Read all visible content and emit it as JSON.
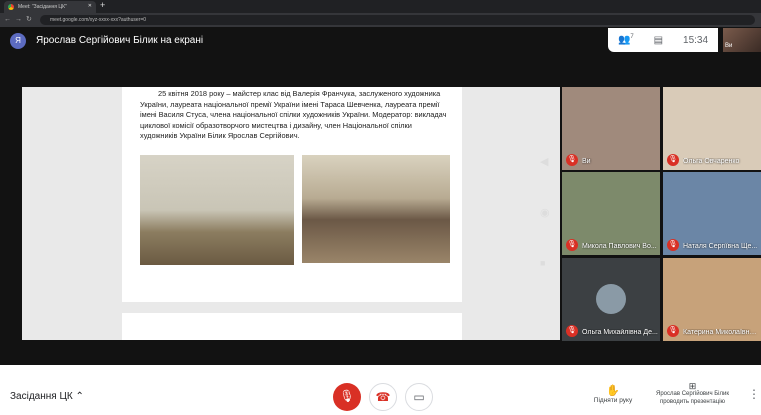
{
  "browser": {
    "tab_title": "Meet: \"Засідання ЦК\"",
    "url": "meet.google.com/xyz-xxxx-xxx?authuser=0"
  },
  "header": {
    "avatar_letter": "Я",
    "presenter_text": "Ярослав Сергійович Білик на екрані",
    "participants_count": "7",
    "time": "15:34",
    "self_label": "Ви"
  },
  "slide": {
    "text": "25 квітня 2018 року – майстер клас від Валерія Франчука, заслуженого художника України, лауреата національної премії України імені Тараса Шевченка, лауреата премії імені Василя Стуса, члена національної спілки художників України. Модератор: викладач циклової комісії образотворчого мистецтва і дизайну, член Національної спілки художників України Білик Ярослав Сергійович."
  },
  "participants": [
    {
      "name": "Ви",
      "bg": "#a08a7c"
    },
    {
      "name": "Ольга Овчаренко",
      "bg": "#d9cbb8"
    },
    {
      "name": "Микола Павлович Во...",
      "bg": "#7d8a6b"
    },
    {
      "name": "Наталя Сергіївна Ще...",
      "bg": "#6b86a6"
    },
    {
      "name": "Ольга Михайлівна Де...",
      "bg": "#3c4043"
    },
    {
      "name": "Катерина Миколаївна...",
      "bg": "#c7a27a"
    }
  ],
  "bottom": {
    "meeting_name": "Засідання ЦК",
    "raise_hand": "Підняти руку",
    "presenting": "Ярослав Сергійович Білик проводить презентацію"
  }
}
